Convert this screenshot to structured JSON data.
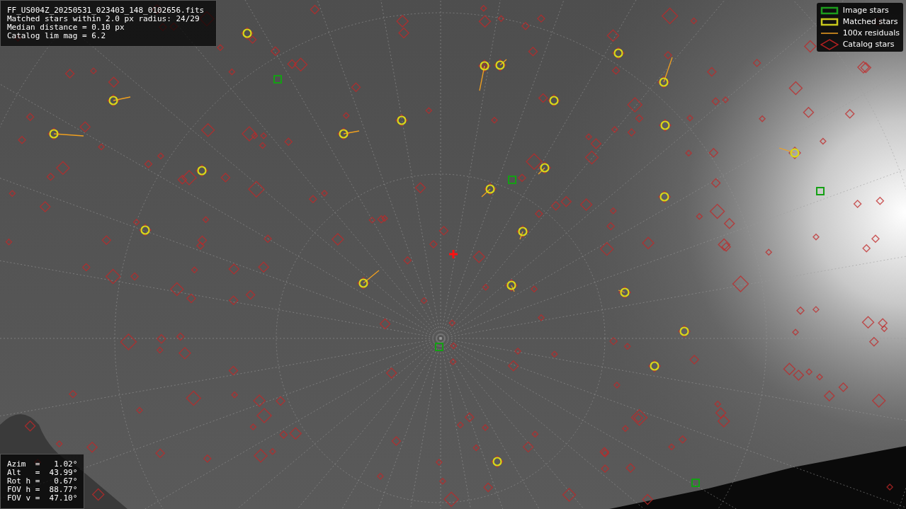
{
  "info_panel": {
    "lines": [
      "FF_US004Z_20250531_023403_148_0102656.fits",
      "Matched stars within 2.0 px radius: 24/29",
      "Median distance = 0.10 px",
      "Catalog lim mag = 6.2"
    ]
  },
  "legend": [
    {
      "kind": "image",
      "label": "Image stars"
    },
    {
      "kind": "matched",
      "label": "Matched stars"
    },
    {
      "kind": "residual",
      "label": "100x residuals"
    },
    {
      "kind": "catalog",
      "label": "Catalog stars"
    }
  ],
  "pointing_panel": {
    "lines": [
      "Azim  =   1.02°",
      "Alt   =  43.99°",
      "Rot h =   0.67°",
      "FOV h =  88.77°",
      "FOV v =  47.10°"
    ]
  }
}
